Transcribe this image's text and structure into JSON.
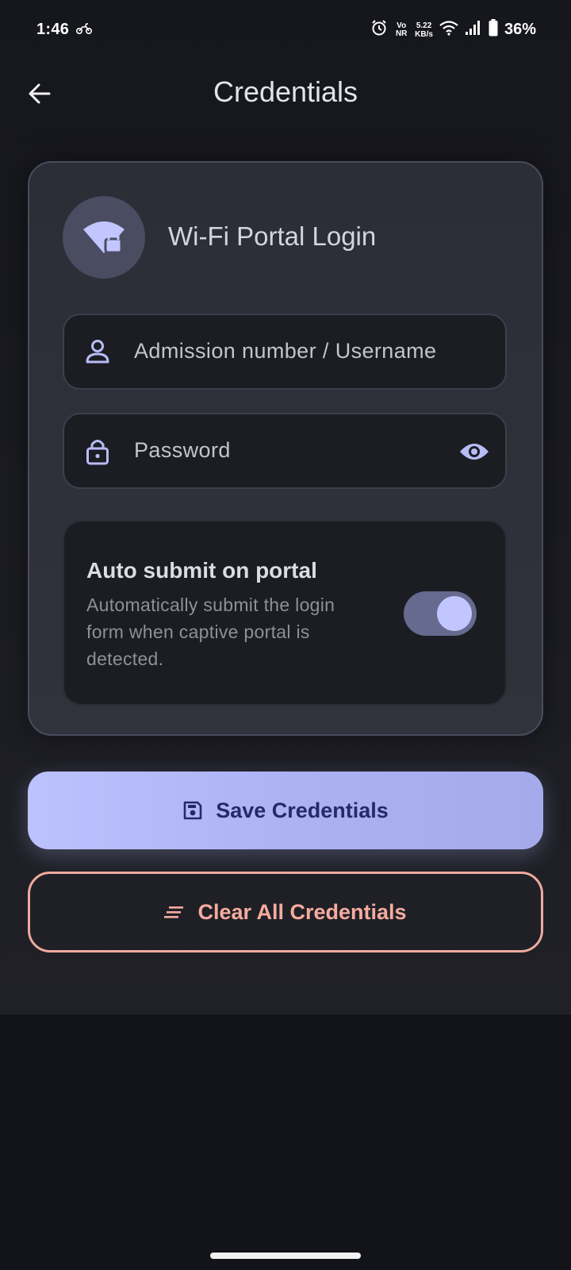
{
  "status_bar": {
    "time": "1:46",
    "volte_top": "Vo",
    "volte_bottom": "NR",
    "speed_value": "5.22",
    "speed_unit": "KB/s",
    "battery_percent": "36%",
    "icons": [
      "motorcycle-icon",
      "alarm-icon",
      "wifi-icon",
      "signal-icon",
      "battery-icon"
    ]
  },
  "app_bar": {
    "title": "Credentials",
    "back_icon": "arrow-back-icon"
  },
  "card": {
    "portal_title": "Wi-Fi Portal Login",
    "portal_icon": "wifi-lock-icon",
    "username_field": {
      "value": "",
      "placeholder": "Admission number / Username",
      "icon": "person-icon"
    },
    "password_field": {
      "value": "",
      "placeholder": "Password",
      "icon": "lock-icon",
      "toggle_icon": "eye-icon"
    },
    "auto_submit": {
      "title": "Auto submit on portal",
      "description": "Automatically submit the login form when captive portal is detected.",
      "enabled": true
    }
  },
  "actions": {
    "save_label": "Save Credentials",
    "save_icon": "floppy-disk-icon",
    "clear_label": "Clear All Credentials",
    "clear_icon": "clear-all-icon"
  },
  "colors": {
    "background": "#13141a",
    "accent": "#bcc2fe",
    "accent_text": "#232b6a",
    "danger": "#f6ab9f",
    "toggle_track": "#666a8f",
    "toggle_knob": "#c2c6ff"
  }
}
